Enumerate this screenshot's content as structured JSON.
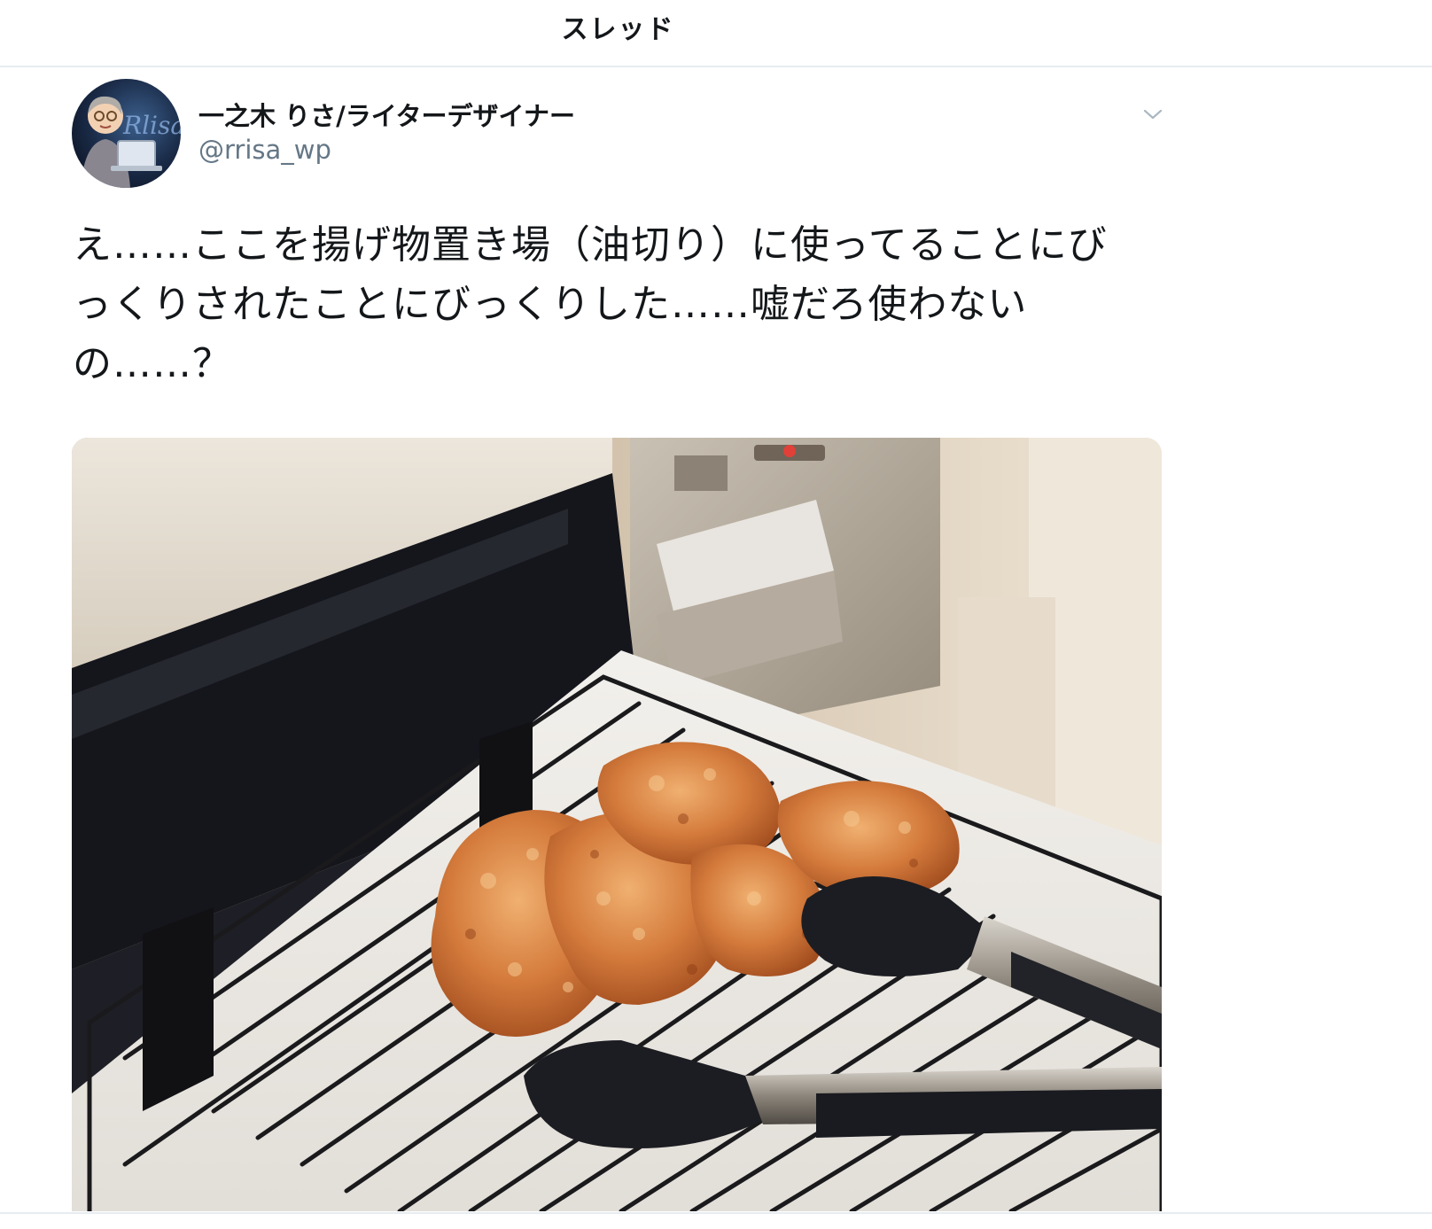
{
  "header": {
    "title": "スレッド"
  },
  "tweet": {
    "author": {
      "display_name": "一之木 りさ/ライターデザイナー",
      "handle": "@rrisa_wp",
      "avatar_text": "Rlisa"
    },
    "menu_icon": "chevron-down-icon",
    "text_lines": [
      "え……ここを揚げ物置き場（油切り）に使ってることにび",
      "っくりされたことにびっくりした……嘘だろ使わない",
      "の……？"
    ],
    "media": {
      "description_icon": "photo-of-fried-chicken-on-oven-rack"
    }
  },
  "colors": {
    "text_primary": "#14171a",
    "text_secondary": "#657786",
    "divider": "#e6ecf0"
  }
}
